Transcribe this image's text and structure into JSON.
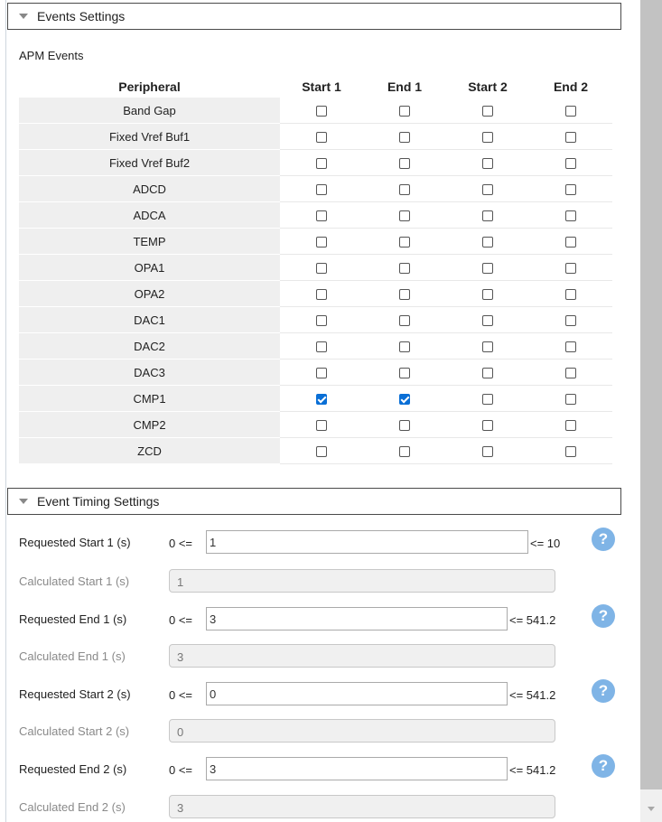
{
  "events_settings": {
    "title": "Events Settings",
    "apm_label": "APM Events"
  },
  "table": {
    "headers": [
      "Peripheral",
      "Start 1",
      "End 1",
      "Start 2",
      "End 2"
    ],
    "rows": [
      {
        "name": "Band Gap",
        "checks": [
          false,
          false,
          false,
          false
        ]
      },
      {
        "name": "Fixed Vref Buf1",
        "checks": [
          false,
          false,
          false,
          false
        ]
      },
      {
        "name": "Fixed Vref Buf2",
        "checks": [
          false,
          false,
          false,
          false
        ]
      },
      {
        "name": "ADCD",
        "checks": [
          false,
          false,
          false,
          false
        ]
      },
      {
        "name": "ADCA",
        "checks": [
          false,
          false,
          false,
          false
        ]
      },
      {
        "name": "TEMP",
        "checks": [
          false,
          false,
          false,
          false
        ]
      },
      {
        "name": "OPA1",
        "checks": [
          false,
          false,
          false,
          false
        ]
      },
      {
        "name": "OPA2",
        "checks": [
          false,
          false,
          false,
          false
        ]
      },
      {
        "name": "DAC1",
        "checks": [
          false,
          false,
          false,
          false
        ]
      },
      {
        "name": "DAC2",
        "checks": [
          false,
          false,
          false,
          false
        ]
      },
      {
        "name": "DAC3",
        "checks": [
          false,
          false,
          false,
          false
        ]
      },
      {
        "name": "CMP1",
        "checks": [
          true,
          true,
          false,
          false
        ]
      },
      {
        "name": "CMP2",
        "checks": [
          false,
          false,
          false,
          false
        ]
      },
      {
        "name": "ZCD",
        "checks": [
          false,
          false,
          false,
          false
        ]
      }
    ]
  },
  "timing": {
    "title": "Event Timing Settings",
    "prefix": "0 <=",
    "req_start1": {
      "label": "Requested Start 1 (s)",
      "value": "1",
      "max": "<= 10"
    },
    "calc_start1": {
      "label": "Calculated Start 1 (s)",
      "value": "1"
    },
    "req_end1": {
      "label": "Requested End 1 (s)",
      "value": "3",
      "max": "<= 541.2"
    },
    "calc_end1": {
      "label": "Calculated End 1 (s)",
      "value": "3"
    },
    "req_start2": {
      "label": "Requested Start 2 (s)",
      "value": "0",
      "max": "<= 541.2"
    },
    "calc_start2": {
      "label": "Calculated Start 2 (s)",
      "value": "0"
    },
    "req_end2": {
      "label": "Requested End 2 (s)",
      "value": "3",
      "max": "<= 541.2"
    },
    "calc_end2": {
      "label": "Calculated End 2 (s)",
      "value": "3"
    },
    "help_glyph": "?"
  },
  "colors": {
    "accent": "#0a6fd6",
    "help": "#7fb4e6"
  }
}
